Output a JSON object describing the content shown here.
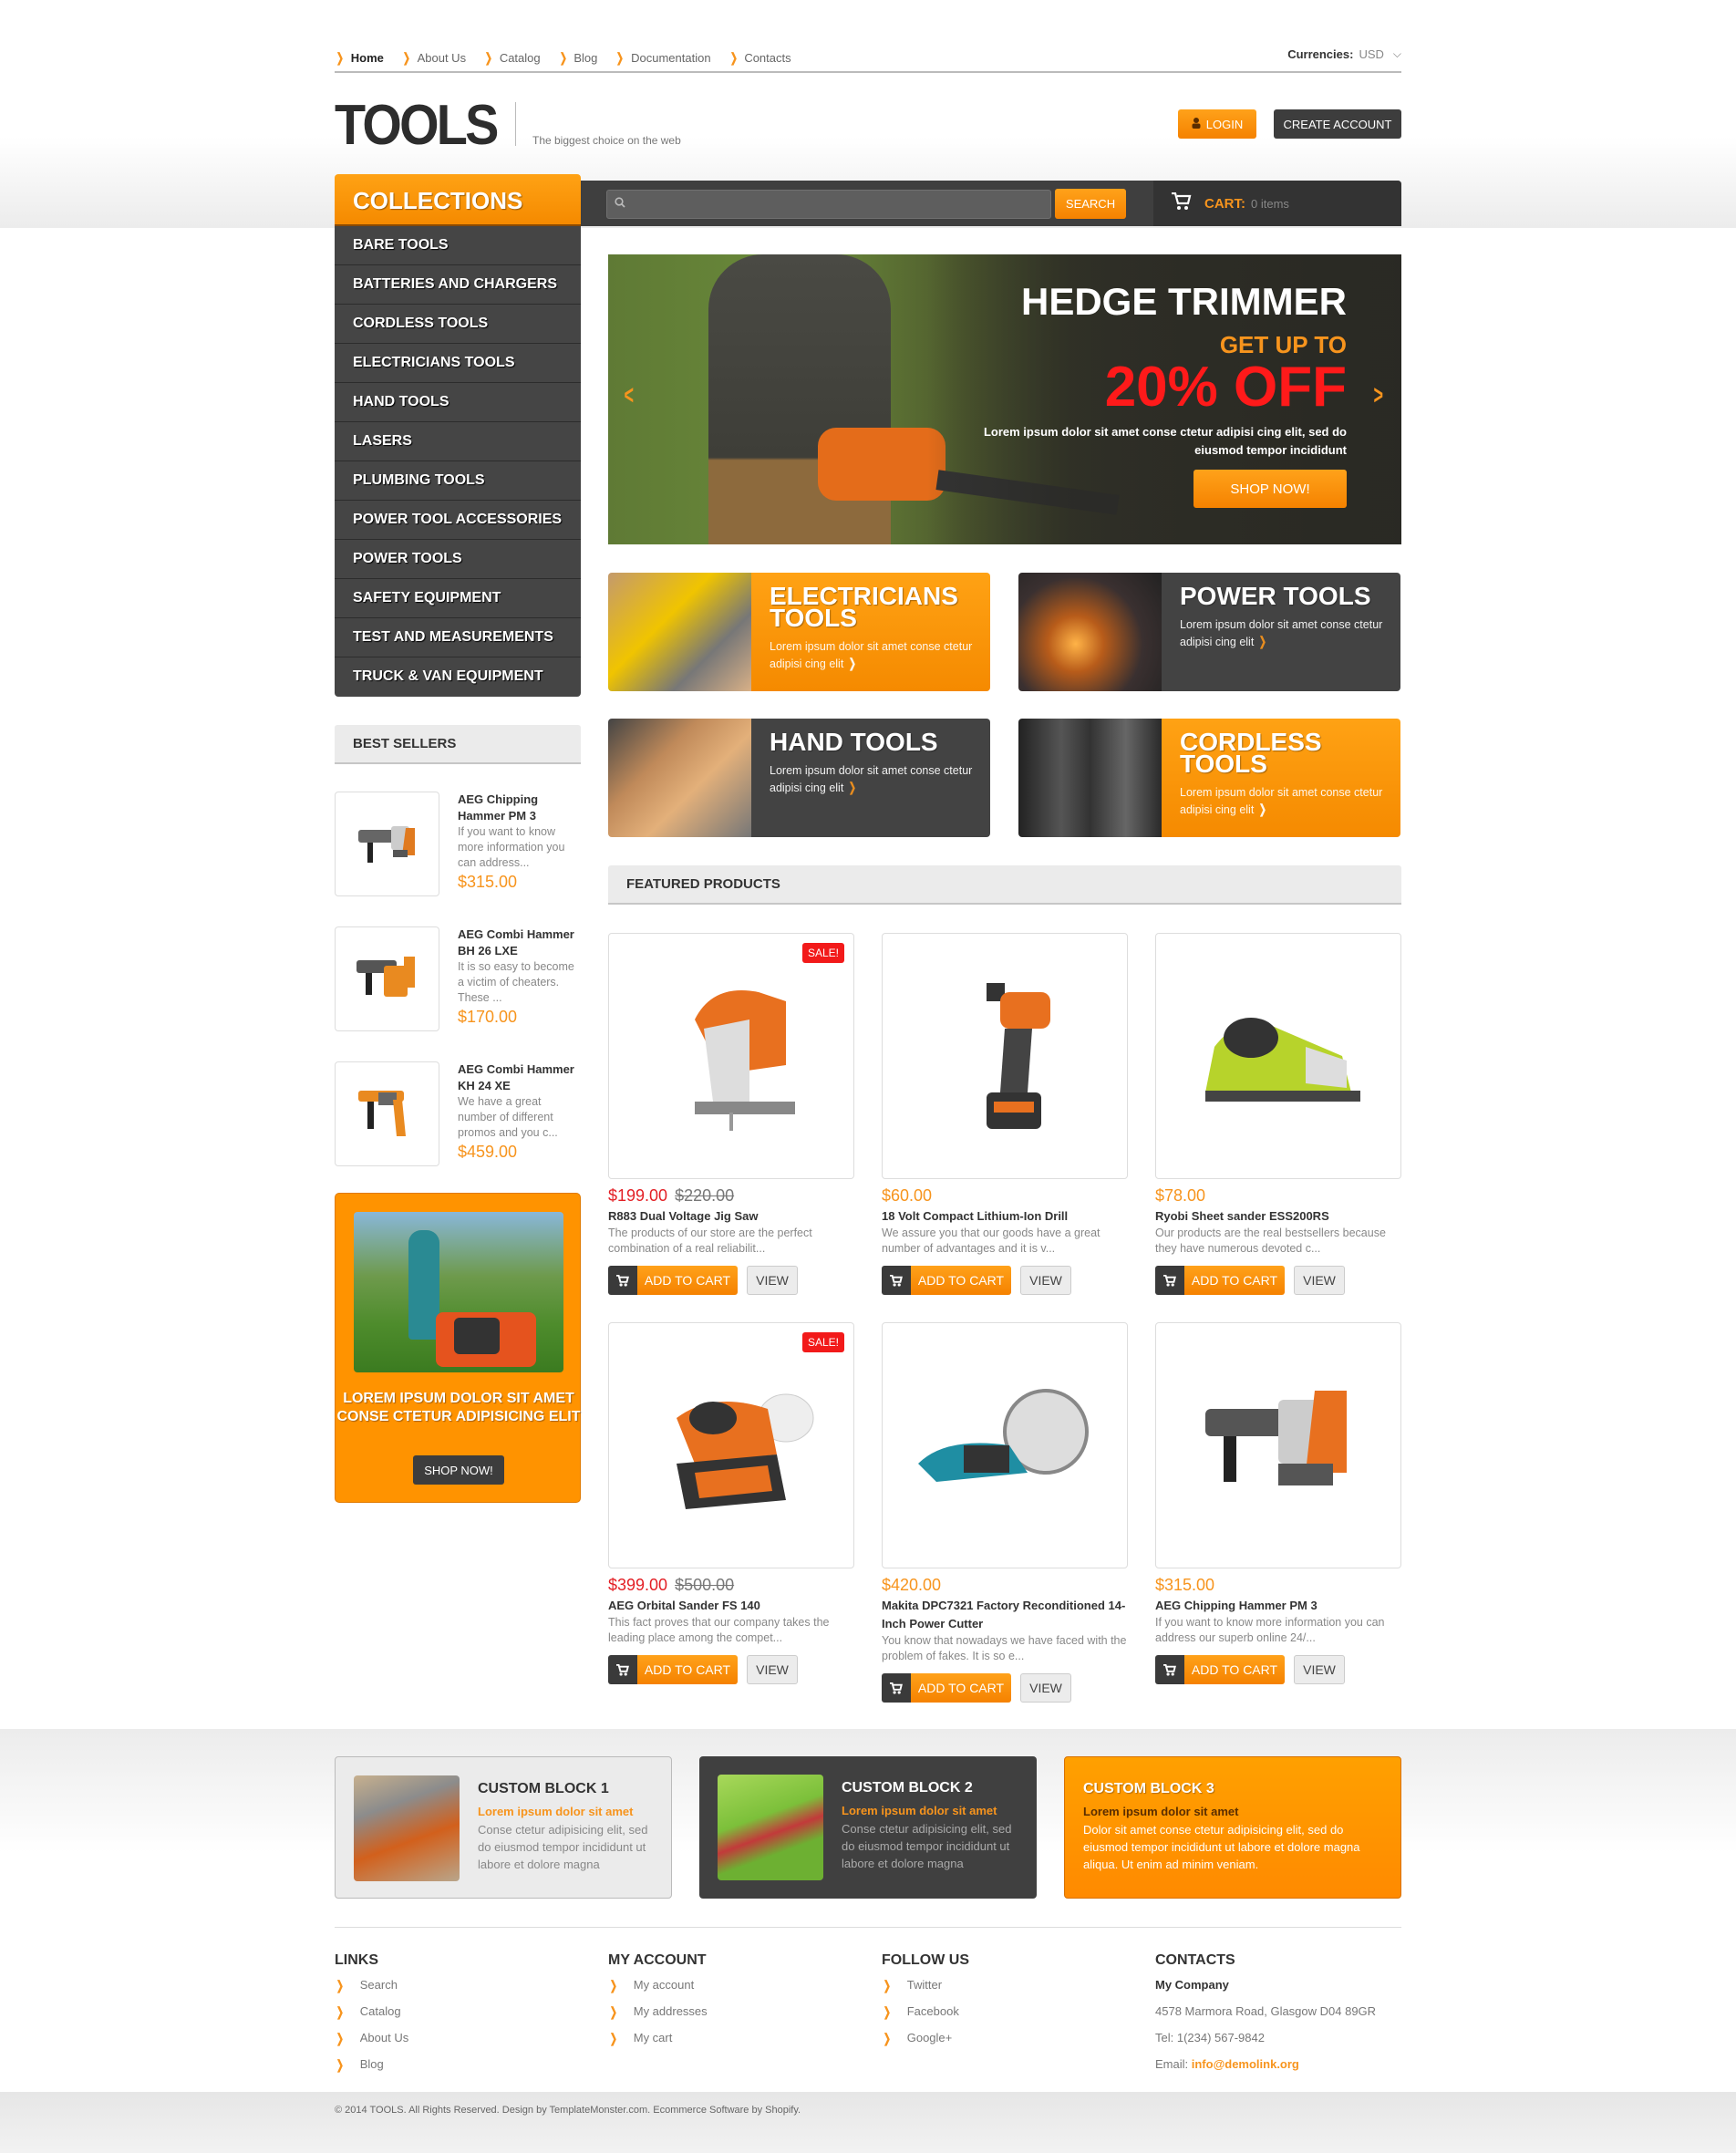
{
  "topnav": {
    "items": [
      {
        "label": "Home",
        "active": true
      },
      {
        "label": "About Us"
      },
      {
        "label": "Catalog"
      },
      {
        "label": "Blog"
      },
      {
        "label": "Documentation"
      },
      {
        "label": "Contacts"
      }
    ],
    "currency_label": "Currencies:",
    "currency_value": "USD"
  },
  "header": {
    "logo": "TOOLS",
    "tagline": "The biggest choice on the web",
    "login_label": "LOGIN",
    "create_account_label": "CREATE ACCOUNT"
  },
  "search": {
    "placeholder": "",
    "button_label": "SEARCH"
  },
  "cart": {
    "label": "CART:",
    "count": "0 items"
  },
  "collections": {
    "title": "COLLECTIONS",
    "items": [
      "BARE TOOLS",
      "BATTERIES AND CHARGERS",
      "CORDLESS TOOLS",
      "ELECTRICIANS TOOLS",
      "HAND TOOLS",
      "LASERS",
      "PLUMBING TOOLS",
      "POWER TOOL ACCESSORIES",
      "POWER TOOLS",
      "SAFETY EQUIPMENT",
      "TEST AND MEASUREMENTS",
      "TRUCK & VAN EQUIPMENT"
    ]
  },
  "best_sellers": {
    "title": "BEST SELLERS",
    "items": [
      {
        "name": "AEG Chipping Hammer PM 3",
        "desc": "If you want to know more information you can address...",
        "price": "$315.00"
      },
      {
        "name": "AEG Combi Hammer BH 26 LXE",
        "desc": "It is so easy to become a victim of cheaters. These ...",
        "price": "$170.00"
      },
      {
        "name": "AEG Combi Hammer KH 24 XE",
        "desc": "We have a great number of different promos and you c...",
        "price": "$459.00"
      }
    ]
  },
  "promo": {
    "title": "LOREM IPSUM DOLOR SIT AMET CONSE CTETUR ADIPISICING ELIT",
    "button_label": "SHOP NOW!"
  },
  "slider": {
    "title": "HEDGE TRIMMER",
    "subtitle": "GET UP TO",
    "discount": "20% OFF",
    "text": "Lorem ipsum dolor sit amet conse ctetur adipisi cing elit, sed do eiusmod tempor incididunt",
    "button_label": "SHOP NOW!"
  },
  "categories": [
    {
      "title": "ELECTRICIANS TOOLS",
      "desc": "Lorem ipsum dolor sit amet conse ctetur adipisi cing elit",
      "style": "orange"
    },
    {
      "title": "POWER TOOLS",
      "desc": "Lorem ipsum dolor sit amet conse ctetur adipisi cing elit",
      "style": "dark"
    },
    {
      "title": "HAND TOOLS",
      "desc": "Lorem ipsum dolor sit amet conse ctetur adipisi cing elit",
      "style": "dark"
    },
    {
      "title": "CORDLESS TOOLS",
      "desc": "Lorem ipsum dolor sit amet conse ctetur adipisi cing elit",
      "style": "orange"
    }
  ],
  "featured": {
    "title": "FEATURED PRODUCTS",
    "add_to_cart_label": "ADD TO CART",
    "view_label": "VIEW",
    "sale_label": "SALE!",
    "products": [
      {
        "name": "R883 Dual Voltage Jig Saw",
        "price": "$199.00",
        "old_price": "$220.00",
        "sale": true,
        "desc": "The products of our store are the perfect combination of a real reliabilit..."
      },
      {
        "name": "18 Volt Compact Lithium-Ion Drill",
        "price": "$60.00",
        "sale": false,
        "desc": "We assure you that our goods have a great number of advantages and it is v..."
      },
      {
        "name": "Ryobi Sheet sander ESS200RS",
        "price": "$78.00",
        "sale": false,
        "desc": "Our products are the real bestsellers because they have numerous devoted c..."
      },
      {
        "name": "AEG Orbital Sander FS 140",
        "price": "$399.00",
        "old_price": "$500.00",
        "sale": true,
        "desc": "This fact proves that our company takes the leading place among the compet..."
      },
      {
        "name": "Makita DPC7321 Factory Reconditioned 14-Inch Power Cutter",
        "price": "$420.00",
        "sale": false,
        "desc": "You know that nowadays we have faced with the problem of fakes. It is so e..."
      },
      {
        "name": "AEG Chipping Hammer PM 3",
        "price": "$315.00",
        "sale": false,
        "desc": "If you want to know more information you can address our superb online 24/..."
      }
    ]
  },
  "custom_blocks": [
    {
      "title": "CUSTOM BLOCK 1",
      "subtitle": "Lorem ipsum dolor sit amet",
      "text": "Conse ctetur adipisicing elit, sed do eiusmod tempor incididunt ut labore et dolore magna"
    },
    {
      "title": "CUSTOM BLOCK 2",
      "subtitle": "Lorem ipsum dolor sit amet",
      "text": "Conse ctetur adipisicing elit, sed do eiusmod tempor incididunt ut labore et dolore magna"
    },
    {
      "title": "CUSTOM BLOCK 3",
      "subtitle": "Lorem ipsum dolor sit amet",
      "text": "Dolor sit amet conse ctetur adipisicing elit, sed do eiusmod tempor incididunt ut labore et dolore magna aliqua. Ut enim ad minim veniam."
    }
  ],
  "footer": {
    "links": {
      "title": "LINKS",
      "items": [
        "Search",
        "Catalog",
        "About Us",
        "Blog"
      ]
    },
    "account": {
      "title": "MY ACCOUNT",
      "items": [
        "My account",
        "My addresses",
        "My cart"
      ]
    },
    "follow": {
      "title": "FOLLOW US",
      "items": [
        "Twitter",
        "Facebook",
        "Google+"
      ]
    },
    "contacts": {
      "title": "CONTACTS",
      "company": "My Company",
      "address": "4578 Marmora Road, Glasgow D04 89GR",
      "tel": "Tel: 1(234) 567-9842",
      "email_label": "Email:",
      "email": "info@demolink.org"
    },
    "copyright": "© 2014 TOOLS. All Rights Reserved. Design by TemplateMonster.com. Ecommerce Software by Shopify."
  },
  "colors": {
    "accent": "#f7941d",
    "dark": "#3f3f3f",
    "sale": "#e31e24"
  }
}
